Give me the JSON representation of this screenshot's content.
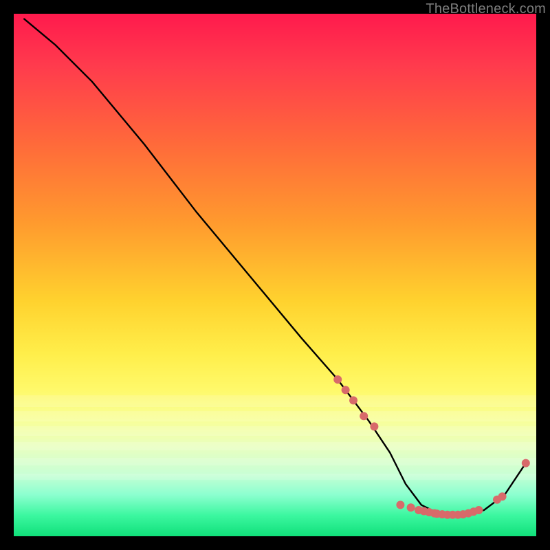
{
  "watermark": "TheBottleneck.com",
  "chart_data": {
    "type": "line",
    "title": "",
    "xlabel": "",
    "ylabel": "",
    "xlim": [
      0,
      100
    ],
    "ylim": [
      0,
      100
    ],
    "grid": false,
    "series": [
      {
        "name": "curve",
        "color": "#000000",
        "x": [
          2,
          8,
          15,
          25,
          35,
          45,
          55,
          62,
          68,
          72,
          75,
          78,
          82,
          86,
          90,
          94,
          98
        ],
        "y": [
          99,
          94,
          87,
          75,
          62,
          50,
          38,
          30,
          22,
          16,
          10,
          6,
          4,
          4,
          5,
          8,
          14
        ]
      }
    ],
    "markers": {
      "name": "highlight-points",
      "color": "#d86a6a",
      "radius": 6,
      "x": [
        62,
        63.5,
        65,
        67,
        69,
        74,
        76,
        77.5,
        78.5,
        79.5,
        80.5,
        81,
        82,
        83,
        84,
        85,
        86,
        87,
        88,
        89,
        92.5,
        93.5,
        98
      ],
      "y": [
        30,
        28,
        26,
        23,
        21,
        6,
        5.5,
        5,
        4.8,
        4.6,
        4.4,
        4.3,
        4.2,
        4.1,
        4.1,
        4.1,
        4.2,
        4.4,
        4.7,
        5,
        7,
        7.6,
        14
      ]
    }
  }
}
